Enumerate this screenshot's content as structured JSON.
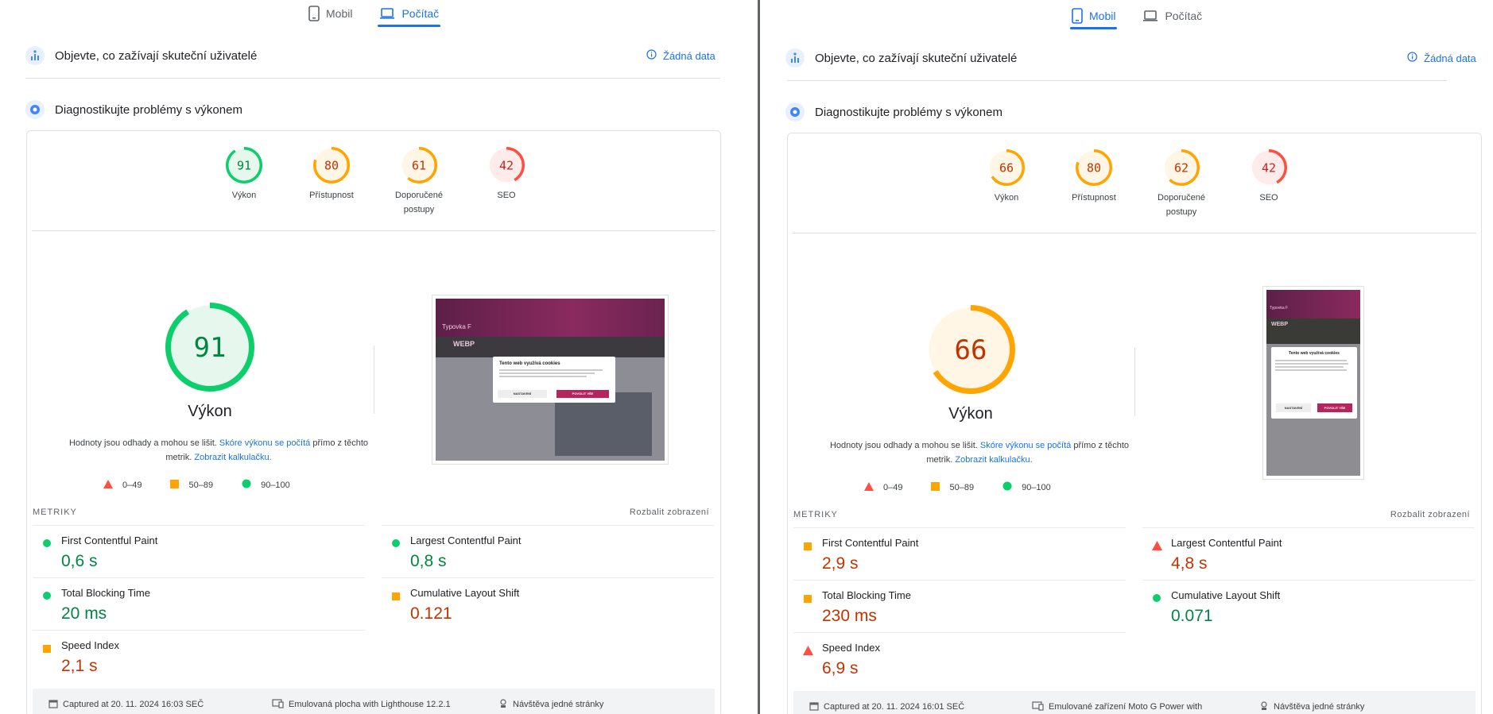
{
  "left": {
    "tabs": [
      {
        "label": "Mobil",
        "active": false
      },
      {
        "label": "Počítač",
        "active": true
      }
    ],
    "field_section": {
      "title": "Objevte, co zažívají skuteční uživatelé",
      "no_data": "Žádná data"
    },
    "diag_section": {
      "title": "Diagnostikujte problémy s výkonem"
    },
    "gauges": [
      {
        "score": 91,
        "label": "Výkon",
        "rating": "good"
      },
      {
        "score": 80,
        "label": "Přístupnost",
        "rating": "average"
      },
      {
        "score": 61,
        "label": "Doporučené postupy",
        "rating": "average"
      },
      {
        "score": 42,
        "label": "SEO",
        "rating": "poor"
      }
    ],
    "big_score": {
      "score": 91,
      "label": "Výkon",
      "rating": "good"
    },
    "description": {
      "text1": "Hodnoty jsou odhady a mohou se lišit. ",
      "link1": "Skóre výkonu se počítá",
      "text2": " přímo z těchto metrik. ",
      "link2": "Zobrazit kalkulačku."
    },
    "legend": [
      {
        "shape": "triangle",
        "range": "0–49"
      },
      {
        "shape": "square",
        "range": "50–89"
      },
      {
        "shape": "circle",
        "range": "90–100"
      }
    ],
    "screenshot": {
      "cookie_title": "Tento web využívá cookies",
      "btn_settings": "NASTAVENÍ",
      "btn_allow": "POVOLIT VŠE",
      "site_name": "Typovka F",
      "heading": "WEBP"
    },
    "metrics_label": "METRIKY",
    "expand_label": "Rozbalit zobrazení",
    "metrics": [
      {
        "name": "First Contentful Paint",
        "value": "0,6 s",
        "rating": "good"
      },
      {
        "name": "Largest Contentful Paint",
        "value": "0,8 s",
        "rating": "good"
      },
      {
        "name": "Total Blocking Time",
        "value": "20 ms",
        "rating": "good"
      },
      {
        "name": "Cumulative Layout Shift",
        "value": "0.121",
        "rating": "average"
      },
      {
        "name": "Speed Index",
        "value": "2,1 s",
        "rating": "average"
      }
    ],
    "footer": {
      "captured": "Captured at 20. 11. 2024 16:03 SEČ",
      "device": "Emulovaná plocha with Lighthouse 12.2.1",
      "visit": "Návštěva jedné stránky"
    }
  },
  "right": {
    "tabs": [
      {
        "label": "Mobil",
        "active": true
      },
      {
        "label": "Počítač",
        "active": false
      }
    ],
    "field_section": {
      "title": "Objevte, co zažívají skuteční uživatelé",
      "no_data": "Žádná data"
    },
    "diag_section": {
      "title": "Diagnostikujte problémy s výkonem"
    },
    "gauges": [
      {
        "score": 66,
        "label": "Výkon",
        "rating": "average"
      },
      {
        "score": 80,
        "label": "Přístupnost",
        "rating": "average"
      },
      {
        "score": 62,
        "label": "Doporučené postupy",
        "rating": "average"
      },
      {
        "score": 42,
        "label": "SEO",
        "rating": "poor"
      }
    ],
    "big_score": {
      "score": 66,
      "label": "Výkon",
      "rating": "average"
    },
    "description": {
      "text1": "Hodnoty jsou odhady a mohou se lišit. ",
      "link1": "Skóre výkonu se počítá",
      "text2": " přímo z těchto metrik. ",
      "link2": "Zobrazit kalkulačku."
    },
    "legend": [
      {
        "shape": "triangle",
        "range": "0–49"
      },
      {
        "shape": "square",
        "range": "50–89"
      },
      {
        "shape": "circle",
        "range": "90–100"
      }
    ],
    "screenshot": {
      "cookie_title": "Tento web využívá cookies",
      "btn_settings": "NASTAVENÍ",
      "btn_allow": "POVOLIT VŠE",
      "site_name": "Typovka F",
      "heading": "WEBP"
    },
    "metrics_label": "METRIKY",
    "expand_label": "Rozbalit zobrazení",
    "metrics": [
      {
        "name": "First Contentful Paint",
        "value": "2,9 s",
        "rating": "average"
      },
      {
        "name": "Largest Contentful Paint",
        "value": "4,8 s",
        "rating": "poor"
      },
      {
        "name": "Total Blocking Time",
        "value": "230 ms",
        "rating": "average"
      },
      {
        "name": "Cumulative Layout Shift",
        "value": "0.071",
        "rating": "good"
      },
      {
        "name": "Speed Index",
        "value": "6,9 s",
        "rating": "poor"
      }
    ],
    "footer": {
      "captured": "Captured at 20. 11. 2024 16:01 SEČ",
      "device": "Emulované zařízení Moto G Power with",
      "visit": "Návštěva jedné stránky"
    }
  },
  "colors": {
    "good": "#0cce6b",
    "good_text": "#018642",
    "good_fill": "#e6f8ee",
    "average": "#ffa400",
    "average_text": "#c33300",
    "average_fill": "#fff6e6",
    "poor": "#ff4e42",
    "poor_text": "#c7221f",
    "poor_fill": "#fdecea",
    "link": "#1a73e8"
  }
}
